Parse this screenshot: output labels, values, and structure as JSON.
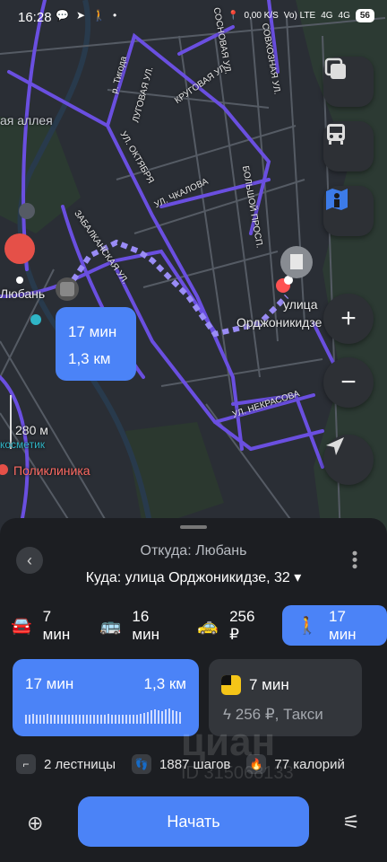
{
  "status_bar": {
    "time": "16:28",
    "speed": "0,00 K/S",
    "network1": "Vo) LTE",
    "network2": "4G",
    "network3": "4G",
    "battery": "56"
  },
  "map": {
    "labels": {
      "lyuban": "Любань",
      "street_ulitsa": "улица",
      "street_ordzh": "Орджоникидзе",
      "alley": "ая аллея",
      "distance": "280 м",
      "cosmetic": "косметик",
      "clinic": "Поликлиника",
      "tigoda": "р. Тигода",
      "krugovaya": "КРУГОВАЯ УЛ.",
      "oktyabrya": "УЛ. ОКТЯБРЯ",
      "chkalova": "УЛ. ЧКАЛОВА",
      "nekrasova": "УЛ. НЕКРАСОВА",
      "sovkhoznaya": "СОВХОЗНАЯ УЛ.",
      "lugovaya": "ЛУГОВАЯ УЛ.",
      "zabalkanskaya": "ЗАБАЛКАНСКАЯ УЛ.",
      "bolshoy": "БОЛЬШОЙ ПРОСП.",
      "sosnovaya": "СОСНОВАЯ УЛ."
    },
    "route_bubble": {
      "time": "17 мин",
      "distance": "1,3 км"
    },
    "buttons": {
      "layers_icon": "layers-icon",
      "transport_icon": "bus-icon",
      "panorama_icon": "panorama-icon",
      "zoom_in": "+",
      "zoom_out": "−",
      "locate_icon": "locate-icon"
    }
  },
  "sheet": {
    "from": "Откуда: Любань",
    "to": "Куда: улица Орджоникидзе, 32 ▾",
    "modes": [
      {
        "icon": "car-icon",
        "label": "7 мин"
      },
      {
        "icon": "bus-icon",
        "label": "16 мин"
      },
      {
        "icon": "taxi-icon",
        "label": "256 ₽"
      },
      {
        "icon": "walk-icon",
        "label": "17 мин"
      }
    ],
    "walk_card": {
      "time": "17 мин",
      "distance": "1,3 км"
    },
    "taxi_card": {
      "time": "7 мин",
      "price": "256 ₽, Такси"
    },
    "facts": [
      {
        "icon": "stairs-icon",
        "label": "2 лестницы"
      },
      {
        "icon": "steps-icon",
        "label": "1887 шагов"
      },
      {
        "icon": "fire-icon",
        "label": "77 калорий"
      }
    ],
    "start_button": "Начать"
  },
  "watermark": {
    "brand": "циан",
    "id": "ID 315068133"
  },
  "colors": {
    "accent": "#4b83f7",
    "route_lines": "#6a4fe0",
    "sheet_bg": "#1c1e22"
  }
}
